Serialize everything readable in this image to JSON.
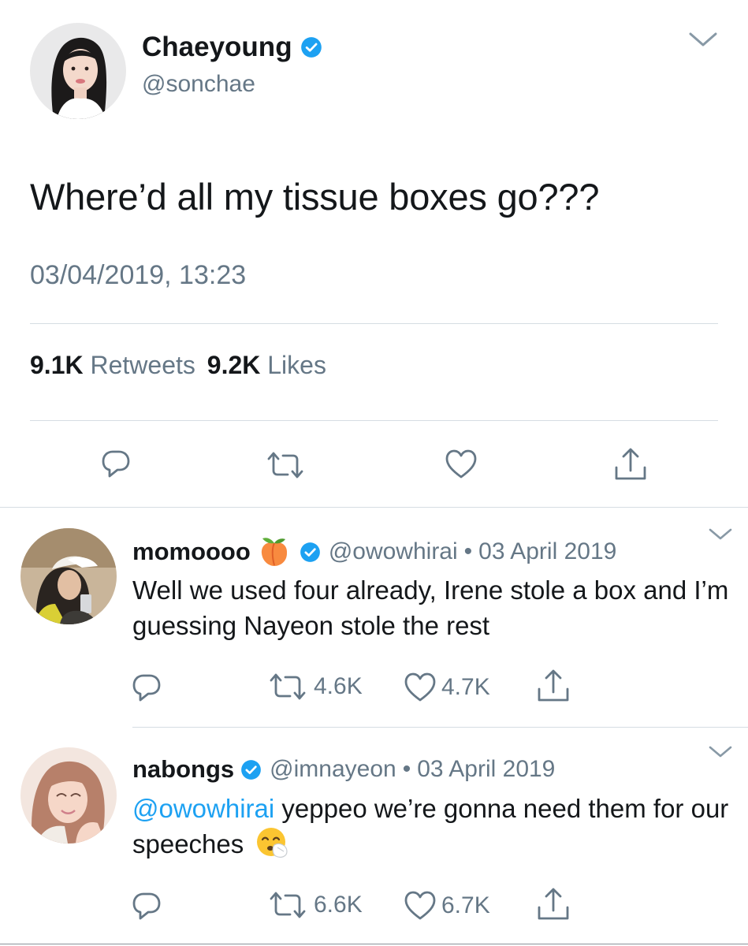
{
  "tweet": {
    "author_name": "Chaeyoung",
    "author_handle": "@sonchae",
    "text": "Where’d all my tissue boxes go???",
    "timestamp": "03/04/2019, 13:23",
    "retweets_count": "9.1K",
    "retweets_label": "Retweets",
    "likes_count": "9.2K",
    "likes_label": "Likes"
  },
  "replies": [
    {
      "name": "momoooo",
      "handle": "@owowhirai",
      "separator": "•",
      "date": "03 April 2019",
      "text": "Well we used four already, Irene stole a box and I’m guessing Nayeon stole the rest",
      "retweets": "4.6K",
      "likes": "4.7K"
    },
    {
      "name": "nabongs",
      "handle": "@imnayeon",
      "separator": "•",
      "date": "03 April 2019",
      "mention": "@owowhirai",
      "text": " yeppeo we’re gonna need them for our speeches",
      "retweets": "6.6K",
      "likes": "6.7K"
    }
  ],
  "colors": {
    "accent": "#1da1f2",
    "text": "#14171a",
    "secondary": "#657786",
    "divider": "#d6dde3"
  },
  "icons": {
    "verified": "verified-badge-icon",
    "reply": "reply-icon",
    "retweet": "retweet-icon",
    "like": "heart-icon",
    "share": "share-icon",
    "menu": "chevron-down-icon",
    "peach": "peach-emoji-icon",
    "sneezing": "sneezing-face-emoji-icon"
  }
}
